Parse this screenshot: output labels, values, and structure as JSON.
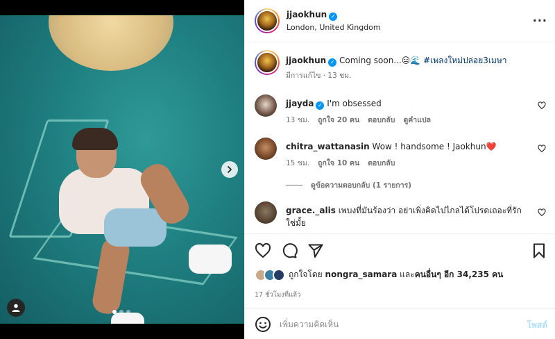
{
  "owner": {
    "username": "jjaokhun",
    "location": "London, United Kingdom"
  },
  "caption": {
    "username": "jjaokhun",
    "text": "Coming soon...😑🌊",
    "hashtag": "#เพลงใหม่ปล่อย3เมษา",
    "meta": "มีการแก้ไข · 13 ชม."
  },
  "comments": [
    {
      "username": "jjayda",
      "verified": true,
      "text": "I'm obsessed",
      "time": "13 ชม.",
      "likes": "ถูกใจ 20 คน",
      "reply": "ตอบกลับ",
      "translate": "ดูคำแปล"
    },
    {
      "username": "chitra_wattanasin",
      "text": "Wow ! handsome ! Jaokhun",
      "emoji": "❤️",
      "time": "15 ชม.",
      "likes": "ถูกใจ 10 คน",
      "reply": "ตอบกลับ",
      "view_replies": "ดูข้อความตอบกลับ (1 รายการ)"
    },
    {
      "username": "grace._alis",
      "text": "เพบงที่มันร้องว่า อย่าเพิ่งคิดไปไกลได้โปรดเถอะที่รัก ใช่มั้ย"
    }
  ],
  "likes": {
    "prefix": "ถูกใจโดย",
    "user": "nongra_samara",
    "and": "และ",
    "others": "คนอื่นๆ อีก 34,235 คน"
  },
  "timestamp": "17 ชั่วโมงที่แล้ว",
  "composer": {
    "placeholder": "เพิ่มความคิดเห็น",
    "post_label": "โพสต์"
  },
  "carousel": {
    "count": 3,
    "active": 0
  },
  "icons": [
    "more-icon",
    "heart-icon",
    "comment-icon",
    "share-icon",
    "bookmark-icon",
    "emoji-icon",
    "chevron-right-icon",
    "user-tag-icon"
  ],
  "colors": {
    "link": "#00376b",
    "verified": "#0095f6",
    "post_button": "#b2dffc",
    "heart": "#e0303b"
  }
}
